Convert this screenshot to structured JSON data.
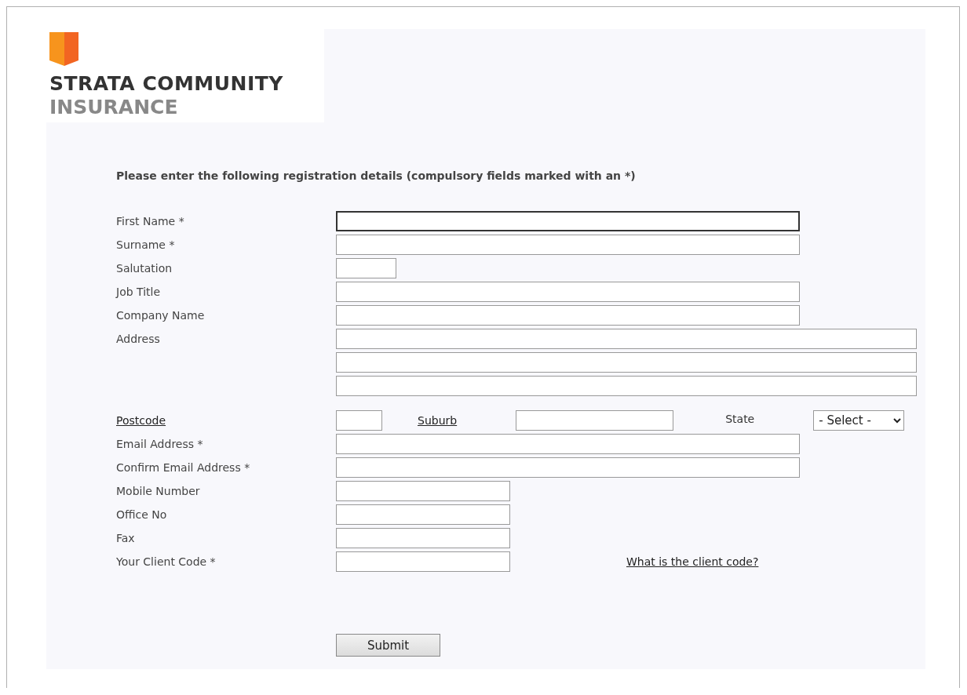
{
  "logo": {
    "line1": "STRATA COMMUNITY",
    "line2": "INSURANCE"
  },
  "heading": "Please enter the following registration details (compulsory fields marked with an *)",
  "rows": [
    {
      "kind": "text",
      "label": "First Name *",
      "field": {
        "kind": "long",
        "focused": true
      }
    },
    {
      "kind": "text",
      "label": "Surname *",
      "field": {
        "kind": "long",
        "focused": false
      }
    },
    {
      "kind": "text",
      "label": "Salutation",
      "field": {
        "kind": "tiny",
        "focused": false
      }
    },
    {
      "kind": "text",
      "label": "Job Title",
      "field": {
        "kind": "long",
        "focused": false
      }
    },
    {
      "kind": "text",
      "label": "Company Name",
      "field": {
        "kind": "long",
        "focused": false
      }
    },
    {
      "kind": "text",
      "label": "Address",
      "field": {
        "kind": "full",
        "focused": false
      }
    },
    {
      "kind": "text",
      "field": {
        "kind": "full",
        "focused": false
      }
    },
    {
      "kind": "text",
      "field": {
        "kind": "full",
        "focused": false
      }
    },
    {
      "kind": "postcode",
      "label": "Postcode",
      "suburb_label": "Suburb",
      "state_label": "State",
      "state_value": "- Select -"
    },
    {
      "kind": "text",
      "label": "Email Address *",
      "field": {
        "kind": "long",
        "focused": false
      }
    },
    {
      "kind": "text",
      "label": "Confirm Email Address *",
      "field": {
        "kind": "long",
        "focused": false
      }
    },
    {
      "kind": "text",
      "label": "Mobile Number",
      "field": {
        "kind": "short",
        "focused": false
      }
    },
    {
      "kind": "text",
      "label": "Office No",
      "field": {
        "kind": "short",
        "focused": false
      }
    },
    {
      "kind": "text",
      "label": "Fax",
      "field": {
        "kind": "short",
        "focused": false
      }
    },
    {
      "kind": "text",
      "label": "Your Client Code *",
      "field": {
        "kind": "short",
        "focused": false
      },
      "link": "What is the client code?"
    }
  ],
  "submit": "Submit"
}
